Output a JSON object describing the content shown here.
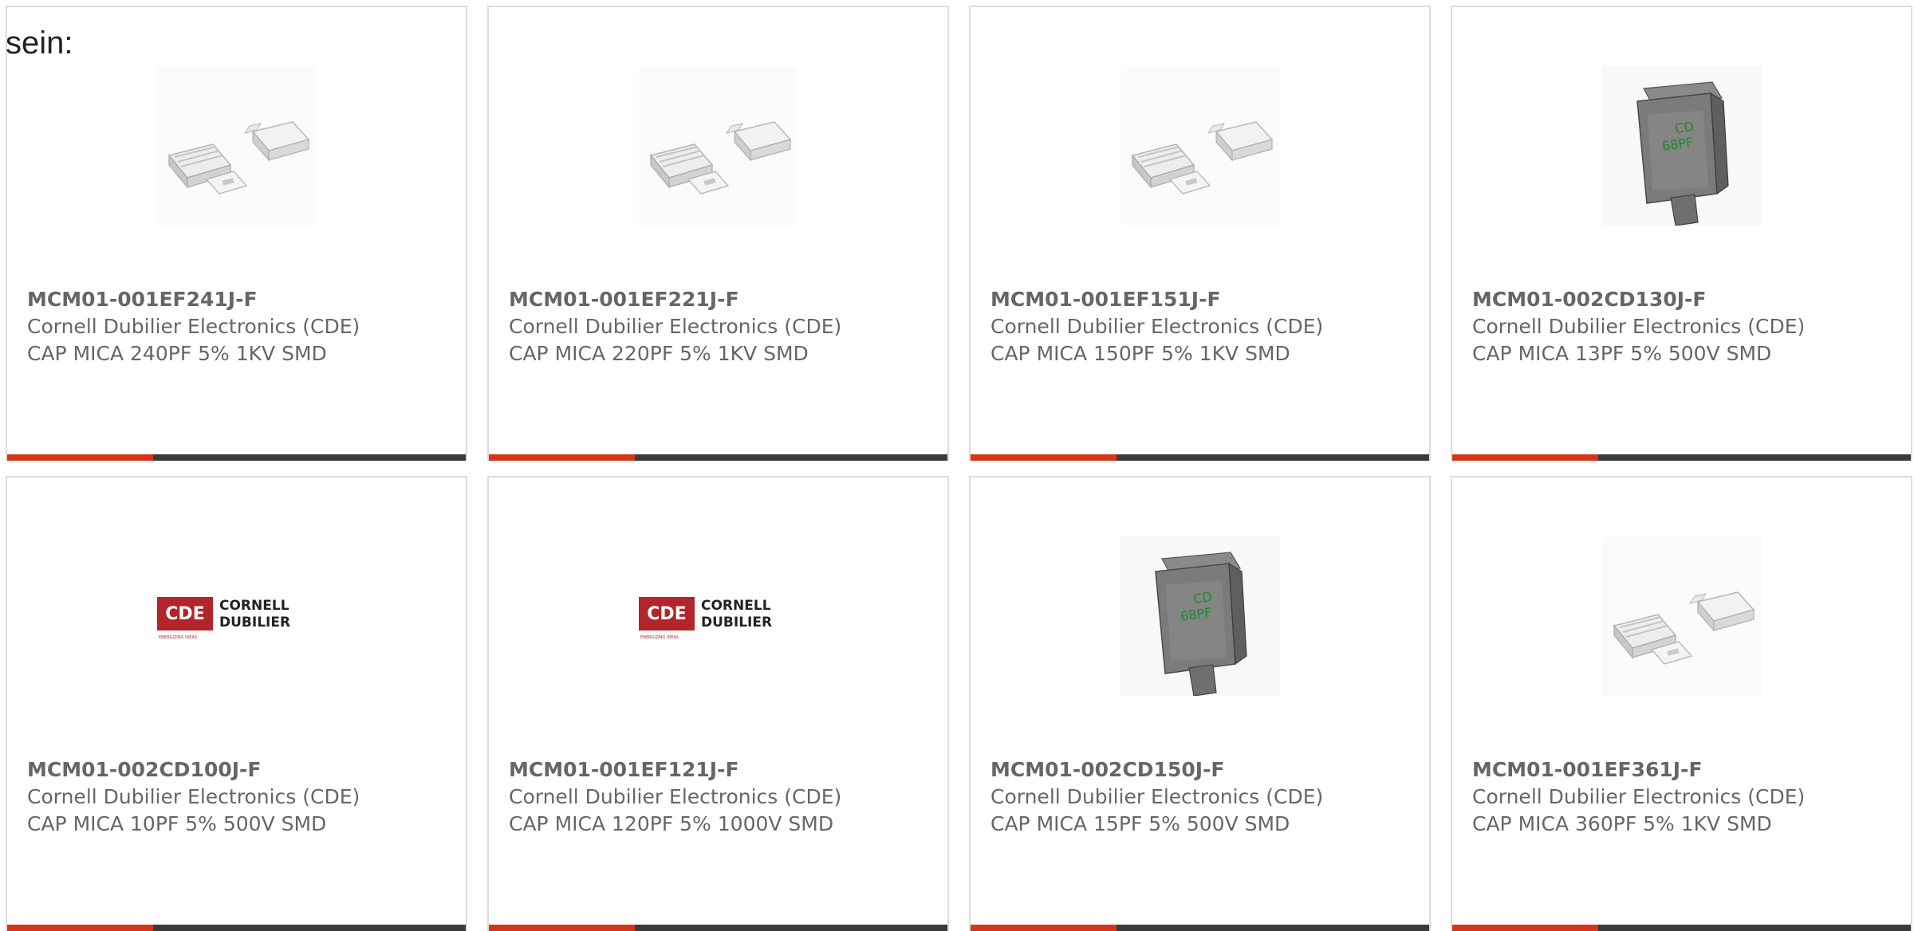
{
  "intro_text": "sein:",
  "colors": {
    "accent": "#d5361b",
    "bar": "#3b3b3b",
    "text": "#666666",
    "border": "#dcdcdc"
  },
  "products": [
    {
      "part_number": "MCM01-001EF241J-F",
      "manufacturer": "Cornell Dubilier Electronics (CDE)",
      "description": "CAP MICA 240PF 5% 1KV SMD",
      "image": "smd-mica-pair"
    },
    {
      "part_number": "MCM01-001EF221J-F",
      "manufacturer": "Cornell Dubilier Electronics (CDE)",
      "description": "CAP MICA 220PF 5% 1KV SMD",
      "image": "smd-mica-pair"
    },
    {
      "part_number": "MCM01-001EF151J-F",
      "manufacturer": "Cornell Dubilier Electronics (CDE)",
      "description": "CAP MICA 150PF 5% 1KV SMD",
      "image": "smd-mica-pair"
    },
    {
      "part_number": "MCM01-002CD130J-F",
      "manufacturer": "Cornell Dubilier Electronics (CDE)",
      "description": "CAP MICA 13PF 5% 500V SMD",
      "image": "mica-capacitor-single"
    },
    {
      "part_number": "MCM01-002CD100J-F",
      "manufacturer": "Cornell Dubilier Electronics (CDE)",
      "description": "CAP MICA 10PF 5% 500V SMD",
      "image": "cde-logo"
    },
    {
      "part_number": "MCM01-001EF121J-F",
      "manufacturer": "Cornell Dubilier Electronics (CDE)",
      "description": "CAP MICA 120PF 5% 1000V SMD",
      "image": "cde-logo"
    },
    {
      "part_number": "MCM01-002CD150J-F",
      "manufacturer": "Cornell Dubilier Electronics (CDE)",
      "description": "CAP MICA 15PF 5% 500V SMD",
      "image": "mica-capacitor-single"
    },
    {
      "part_number": "MCM01-001EF361J-F",
      "manufacturer": "Cornell Dubilier Electronics (CDE)",
      "description": "CAP MICA 360PF 5% 1KV SMD",
      "image": "smd-mica-pair"
    }
  ],
  "logo": {
    "mark": "CDE",
    "line1": "CORNELL",
    "line2": "DUBILIER",
    "tagline": "ENERGIZING IDEAS"
  },
  "component_marking": {
    "line1": "CD",
    "line2": "68PF"
  }
}
